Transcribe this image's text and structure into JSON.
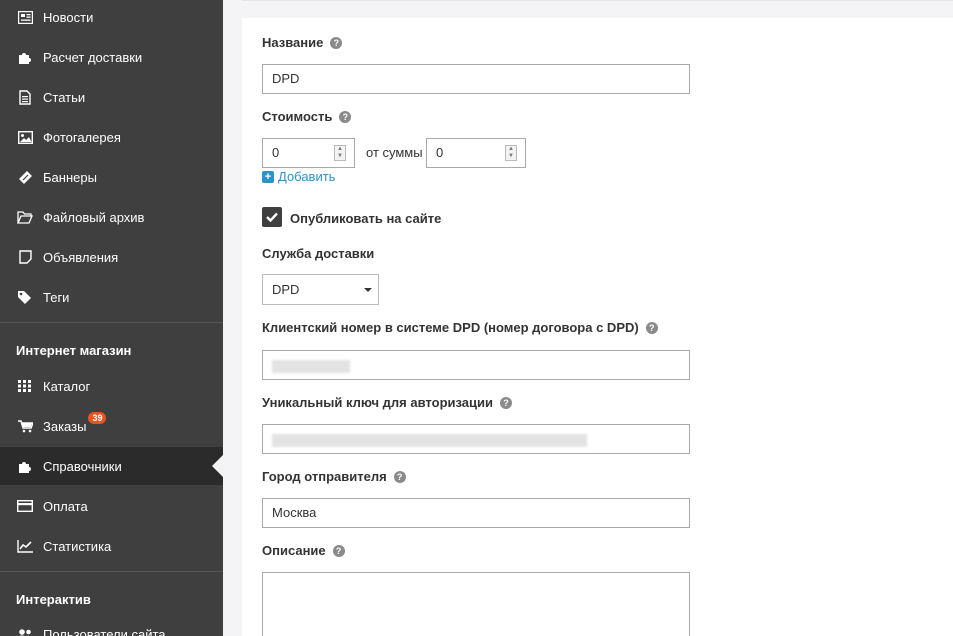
{
  "sidebar": {
    "items": [
      {
        "label": "Новости",
        "icon": "newspaper-icon"
      },
      {
        "label": "Расчет доставки",
        "icon": "puzzle-icon"
      },
      {
        "label": "Статьи",
        "icon": "document-icon"
      },
      {
        "label": "Фотогалерея",
        "icon": "image-icon"
      },
      {
        "label": "Баннеры",
        "icon": "ticket-icon"
      },
      {
        "label": "Файловый архив",
        "icon": "folder-icon"
      },
      {
        "label": "Объявления",
        "icon": "note-icon"
      },
      {
        "label": "Теги",
        "icon": "tags-icon"
      }
    ],
    "shop_section": "Интернет магазин",
    "shop_items": [
      {
        "label": "Каталог",
        "icon": "grid-icon"
      },
      {
        "label": "Заказы",
        "icon": "cart-icon",
        "badge": "39"
      },
      {
        "label": "Справочники",
        "icon": "puzzle-icon",
        "active": true
      },
      {
        "label": "Оплата",
        "icon": "credit-card-icon"
      },
      {
        "label": "Статистика",
        "icon": "chart-icon"
      }
    ],
    "interactive_section": "Интерактив",
    "interactive_items": [
      {
        "label": "Пользователи сайта",
        "icon": "users-icon"
      }
    ]
  },
  "form": {
    "name_label": "Название",
    "name_value": "DPD",
    "cost_label": "Стоимость",
    "cost_value": "0",
    "from_sum_label": "от суммы",
    "from_sum_value": "0",
    "add_label": "Добавить",
    "publish_label": "Опубликовать на сайте",
    "publish_checked": true,
    "service_label": "Служба доставки",
    "service_value": "DPD",
    "client_number_label": "Клиентский номер в системе DPD (номер договора с DPD)",
    "auth_key_label": "Уникальный ключ для авторизации",
    "city_label": "Город отправителя",
    "city_value": "Москва",
    "description_label": "Описание"
  },
  "colors": {
    "sidebar_bg": "#3f3f3f",
    "sidebar_active": "#2b2b2b",
    "badge": "#e8541e",
    "link": "#2a93c9"
  }
}
